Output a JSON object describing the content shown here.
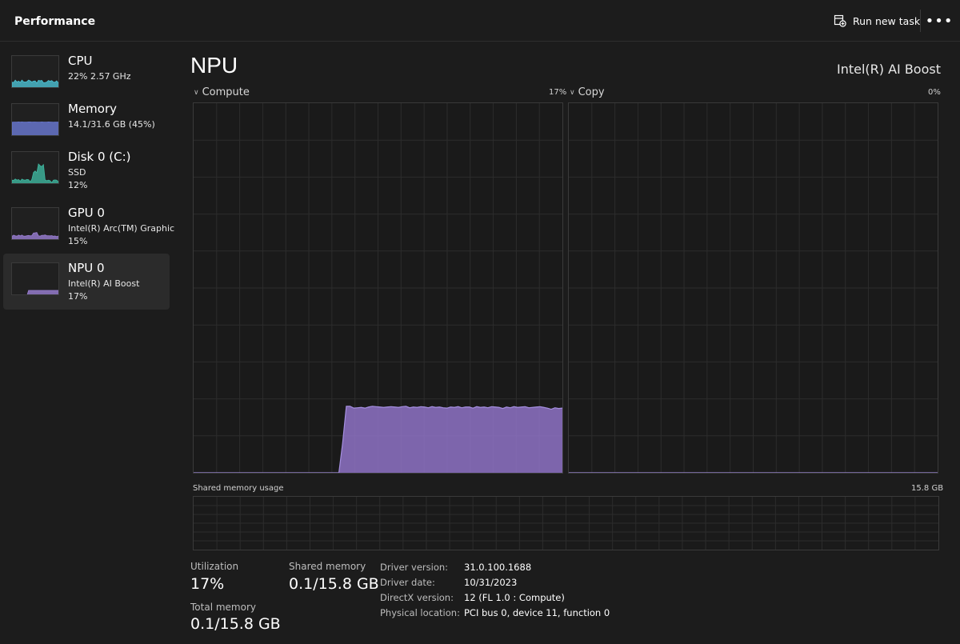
{
  "header": {
    "title": "Performance",
    "run_task_label": "Run new task",
    "more_label": "•••"
  },
  "sidebar": {
    "items": [
      {
        "name": "CPU",
        "lines": [
          "22%  2.57 GHz"
        ],
        "color": "#4cc2d4",
        "icon": "cpu-thumbnail",
        "usage": 22
      },
      {
        "name": "Memory",
        "lines": [
          "14.1/31.6 GB (45%)"
        ],
        "color": "#6b7bd6",
        "icon": "memory-thumbnail",
        "usage": 45
      },
      {
        "name": "Disk 0 (C:)",
        "lines": [
          "SSD",
          "12%"
        ],
        "color": "#3fb8a0",
        "icon": "disk-thumbnail",
        "usage": 12
      },
      {
        "name": "GPU 0",
        "lines": [
          "Intel(R) Arc(TM) Graphic",
          "15%"
        ],
        "color": "#9b7fd4",
        "icon": "gpu-thumbnail",
        "usage": 15
      },
      {
        "name": "NPU 0",
        "lines": [
          "Intel(R) AI Boost",
          "17%"
        ],
        "color": "#9b7fd4",
        "icon": "npu-thumbnail",
        "usage": 17,
        "selected": true
      }
    ]
  },
  "main": {
    "title": "NPU",
    "device": "Intel(R) AI Boost",
    "graphs": [
      {
        "label": "Compute",
        "percent": "17%"
      },
      {
        "label": "Copy",
        "percent": "0%"
      }
    ],
    "shared_label": "Shared memory usage",
    "shared_max": "15.8 GB",
    "stats": {
      "utilization_label": "Utilization",
      "utilization_value": "17%",
      "shared_memory_label": "Shared memory",
      "shared_memory_value": "0.1/15.8 GB",
      "total_memory_label": "Total memory",
      "total_memory_value": "0.1/15.8 GB"
    },
    "info": [
      {
        "key": "Driver version:",
        "value": "31.0.100.1688"
      },
      {
        "key": "Driver date:",
        "value": "10/31/2023"
      },
      {
        "key": "DirectX version:",
        "value": "12 (FL 1.0 : Compute)"
      },
      {
        "key": "Physical location:",
        "value": "PCI bus 0, device 11, function 0"
      }
    ]
  },
  "chart_data": [
    {
      "type": "area",
      "title": "Compute",
      "ylim": [
        0,
        100
      ],
      "color": "#8f73c7",
      "values": [
        0,
        0,
        0,
        0,
        0,
        0,
        0,
        0,
        0,
        0,
        0,
        0,
        0,
        0,
        0,
        0,
        0,
        0,
        0,
        0,
        0,
        0,
        0,
        0,
        0,
        0,
        0,
        0,
        0,
        0,
        0,
        0,
        0,
        0,
        0,
        0,
        0,
        0,
        0,
        0,
        8,
        18,
        18,
        17.5,
        17.6,
        17.7,
        17.5,
        17.8,
        18,
        17.9,
        17.8,
        17.7,
        17.8,
        17.9,
        17.8,
        17.7,
        17.9,
        18,
        17.6,
        17.8,
        17.7,
        17.9,
        17.8,
        17.6,
        17.9,
        17.7,
        17.8,
        17.6,
        17.5,
        17.8,
        17.7,
        17.9,
        17.6,
        17.8,
        17.8,
        17.5,
        17.9,
        17.7,
        17.8,
        17.6,
        17.9,
        17.8,
        17.7,
        17.4,
        17.8,
        17.6,
        17.9,
        17.7,
        17.8,
        17.9,
        17.6,
        17.7,
        17.8,
        17.9,
        17.7,
        17.5,
        17.2,
        17.6,
        17.4,
        17.5
      ]
    },
    {
      "type": "area",
      "title": "Copy",
      "ylim": [
        0,
        100
      ],
      "color": "#8f73c7",
      "values": [
        0
      ]
    }
  ]
}
